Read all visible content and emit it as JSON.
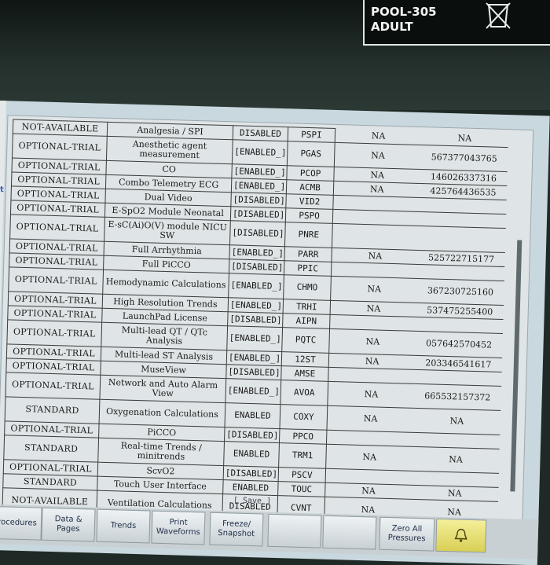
{
  "header": {
    "bed": "POOL-305",
    "patient_type": "ADULT"
  },
  "side_label": "nt",
  "save_label": "[ Save ]",
  "rows": [
    {
      "status": "NOT-AVAILABLE",
      "option": "Analgesia / SPI",
      "state": "DISABLED",
      "code": "PSPI",
      "na": "NA",
      "key": "NA"
    },
    {
      "status": "OPTIONAL-TRIAL",
      "option": "Anesthetic agent measurement",
      "state": "[ENABLED_]",
      "code": "PGAS",
      "na": "NA",
      "key": "567377043765"
    },
    {
      "status": "OPTIONAL-TRIAL",
      "option": "CO",
      "state": "[ENABLED_]",
      "code": "PCOP",
      "na": "NA",
      "key": "146026337316"
    },
    {
      "status": "OPTIONAL-TRIAL",
      "option": "Combo Telemetry ECG",
      "state": "[ENABLED_]",
      "code": "ACMB",
      "na": "NA",
      "key": "425764436535"
    },
    {
      "status": "OPTIONAL-TRIAL",
      "option": "Dual Video",
      "state": "[DISABLED]",
      "code": "VID2",
      "na": "",
      "key": ""
    },
    {
      "status": "OPTIONAL-TRIAL",
      "option": "E-SpO2 Module Neonatal",
      "state": "[DISABLED]",
      "code": "PSPO",
      "na": "",
      "key": ""
    },
    {
      "status": "OPTIONAL-TRIAL",
      "option": "E-sC(Ai)O(V) module NICU SW",
      "state": "[DISABLED]",
      "code": "PNRE",
      "na": "",
      "key": ""
    },
    {
      "status": "OPTIONAL-TRIAL",
      "option": "Full Arrhythmia",
      "state": "[ENABLED_]",
      "code": "PARR",
      "na": "NA",
      "key": "525722715177"
    },
    {
      "status": "OPTIONAL-TRIAL",
      "option": "Full PiCCO",
      "state": "[DISABLED]",
      "code": "PPIC",
      "na": "",
      "key": ""
    },
    {
      "status": "OPTIONAL-TRIAL",
      "option": "Hemodynamic Calculations",
      "state": "[ENABLED_]",
      "code": "CHMO",
      "na": "NA",
      "key": "367230725160"
    },
    {
      "status": "OPTIONAL-TRIAL",
      "option": "High Resolution Trends",
      "state": "[ENABLED_]",
      "code": "TRHI",
      "na": "NA",
      "key": "537475255400"
    },
    {
      "status": "OPTIONAL-TRIAL",
      "option": "LaunchPad License",
      "state": "[DISABLED]",
      "code": "AIPN",
      "na": "",
      "key": ""
    },
    {
      "status": "OPTIONAL-TRIAL",
      "option": "Multi-lead QT / QTc Analysis",
      "state": "[ENABLED_]",
      "code": "PQTC",
      "na": "NA",
      "key": "057642570452"
    },
    {
      "status": "OPTIONAL-TRIAL",
      "option": "Multi-lead ST Analysis",
      "state": "[ENABLED_]",
      "code": "12ST",
      "na": "NA",
      "key": "203346541617"
    },
    {
      "status": "OPTIONAL-TRIAL",
      "option": "MuseView",
      "state": "[DISABLED]",
      "code": "AMSE",
      "na": "",
      "key": ""
    },
    {
      "status": "OPTIONAL-TRIAL",
      "option": "Network and Auto Alarm View",
      "state": "[ENABLED_]",
      "code": "AVOA",
      "na": "NA",
      "key": "665532157372"
    },
    {
      "status": "STANDARD",
      "option": "Oxygenation Calculations",
      "state": "ENABLED",
      "code": "COXY",
      "na": "NA",
      "key": "NA"
    },
    {
      "status": "OPTIONAL-TRIAL",
      "option": "PiCCO",
      "state": "[DISABLED]",
      "code": "PPCO",
      "na": "",
      "key": ""
    },
    {
      "status": "STANDARD",
      "option": "Real-time Trends / minitrends",
      "state": "ENABLED",
      "code": "TRM1",
      "na": "NA",
      "key": "NA"
    },
    {
      "status": "OPTIONAL-TRIAL",
      "option": "ScvO2",
      "state": "[DISABLED]",
      "code": "PSCV",
      "na": "",
      "key": ""
    },
    {
      "status": "STANDARD",
      "option": "Touch User Interface",
      "state": "ENABLED",
      "code": "TOUC",
      "na": "NA",
      "key": "NA"
    },
    {
      "status": "NOT-AVAILABLE",
      "option": "Ventilation Calculations",
      "state": "DISABLED",
      "code": "CVNT",
      "na": "NA",
      "key": "NA"
    }
  ],
  "toolbar": [
    {
      "label": "Procedures"
    },
    {
      "label": "Data & Pages"
    },
    {
      "label": "Trends"
    },
    {
      "label": "Print Waveforms"
    },
    {
      "label": "Freeze/ Snapshot"
    },
    {
      "label": ""
    },
    {
      "label": ""
    },
    {
      "label": "Zero All Pressures"
    }
  ]
}
